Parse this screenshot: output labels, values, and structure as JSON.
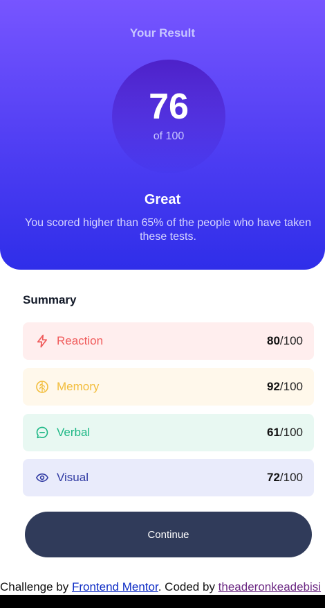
{
  "result": {
    "title": "Your Result",
    "score": "76",
    "max_label": "of 100",
    "rating": "Great",
    "description": "You scored higher than 65% of the people who have taken these tests."
  },
  "summary": {
    "title": "Summary",
    "items": [
      {
        "label": "Reaction",
        "score": "80",
        "max": "/100",
        "icon": "lightning-icon",
        "accent": "#f05a5a",
        "background": "#ffeeee"
      },
      {
        "label": "Memory",
        "score": "92",
        "max": "/100",
        "icon": "brain-icon",
        "accent": "#f2bd3b",
        "background": "#fff8eb"
      },
      {
        "label": "Verbal",
        "score": "61",
        "max": "/100",
        "icon": "chat-icon",
        "accent": "#1cb785",
        "background": "#e8f8f2"
      },
      {
        "label": "Visual",
        "score": "72",
        "max": "/100",
        "icon": "eye-icon",
        "accent": "#2f39a2",
        "background": "#e9ebfb"
      }
    ]
  },
  "continue_label": "Continue",
  "attribution": {
    "prefix": "Challenge by ",
    "link1": "Frontend Mentor",
    "middle": ". Coded by ",
    "link2": "theaderonkeadebisi"
  },
  "colors": {
    "gradient_top": "#7755ff",
    "gradient_bottom": "#2f2ee9",
    "button": "#303b5a"
  }
}
